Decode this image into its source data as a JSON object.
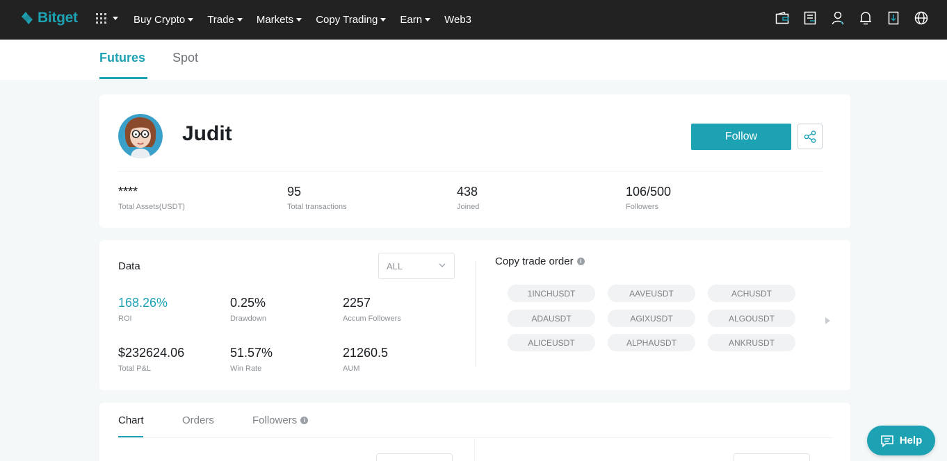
{
  "colors": {
    "brand": "#1da2b4",
    "nav_bg": "#222222",
    "page_bg": "#f4f8f9"
  },
  "nav": {
    "logo_text": "Bitget",
    "apps_icon": "grid-icon",
    "menu": [
      {
        "label": "Buy Crypto",
        "has_dropdown": true
      },
      {
        "label": "Trade",
        "has_dropdown": true
      },
      {
        "label": "Markets",
        "has_dropdown": true
      },
      {
        "label": "Copy Trading",
        "has_dropdown": true
      },
      {
        "label": "Earn",
        "has_dropdown": true
      },
      {
        "label": "Web3",
        "has_dropdown": false
      }
    ],
    "right_icons": [
      "wallet-icon",
      "orders-icon",
      "user-icon",
      "bell-icon",
      "download-icon",
      "globe-icon"
    ]
  },
  "subtabs": {
    "futures": "Futures",
    "spot": "Spot",
    "active": "Futures"
  },
  "profile": {
    "name": "Judit",
    "follow_label": "Follow",
    "share_icon": "share-icon",
    "stats": [
      {
        "value": "****",
        "label": "Total Assets(USDT)"
      },
      {
        "value": "95",
        "label": "Total transactions"
      },
      {
        "value": "438",
        "label": "Joined"
      },
      {
        "value": "106/500",
        "label": "Followers"
      }
    ]
  },
  "data_panel": {
    "title": "Data",
    "period_select": "ALL",
    "metrics": [
      {
        "value": "168.26%",
        "label": "ROI"
      },
      {
        "value": "0.25%",
        "label": "Drawdown"
      },
      {
        "value": "2257",
        "label": "Accum Followers"
      },
      {
        "value": "$232624.06",
        "label": "Total P&L"
      },
      {
        "value": "51.57%",
        "label": "Win Rate"
      },
      {
        "value": "21260.5",
        "label": "AUM"
      }
    ]
  },
  "copy_trade": {
    "title": "Copy trade order",
    "pairs": [
      "1INCHUSDT",
      "AAVEUSDT",
      "ACHUSDT",
      "ADAUSDT",
      "AGIXUSDT",
      "ALGOUSDT",
      "ALICEUSDT",
      "ALPHAUSDT",
      "ANKRUSDT"
    ]
  },
  "bottom_tabs": {
    "chart": "Chart",
    "orders": "Orders",
    "followers": "Followers",
    "active": "Chart"
  },
  "help": {
    "label": "Help"
  }
}
